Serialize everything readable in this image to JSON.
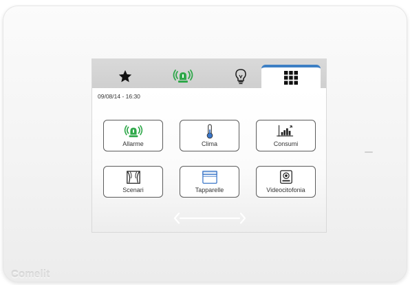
{
  "device": {
    "brand": "Comelit",
    "frame_color": "#f5f5f5"
  },
  "tabs": [
    {
      "name": "favorites",
      "icon": "star-icon",
      "active": false
    },
    {
      "name": "alarm",
      "icon": "alarm-icon",
      "active": false
    },
    {
      "name": "lighting",
      "icon": "lightbulb-icon",
      "active": false
    },
    {
      "name": "menu",
      "icon": "grid-icon",
      "active": true
    }
  ],
  "screen": {
    "datetime": "09/08/14 - 16:30"
  },
  "tiles": [
    {
      "label": "Allarme",
      "icon": "alarm-icon"
    },
    {
      "label": "Clima",
      "icon": "thermometer-icon"
    },
    {
      "label": "Consumi",
      "icon": "chart-icon"
    },
    {
      "label": "Scenari",
      "icon": "curtain-icon"
    },
    {
      "label": "Tapparelle",
      "icon": "shutter-icon"
    },
    {
      "label": "Videocitofonia",
      "icon": "intercom-icon"
    }
  ],
  "navigation": {
    "icon": "swipe-arrows-icon"
  },
  "colors": {
    "accent_green": "#2fa84a",
    "active_tab": "#3d7fc4",
    "thermo_blue": "#3a76c8"
  }
}
